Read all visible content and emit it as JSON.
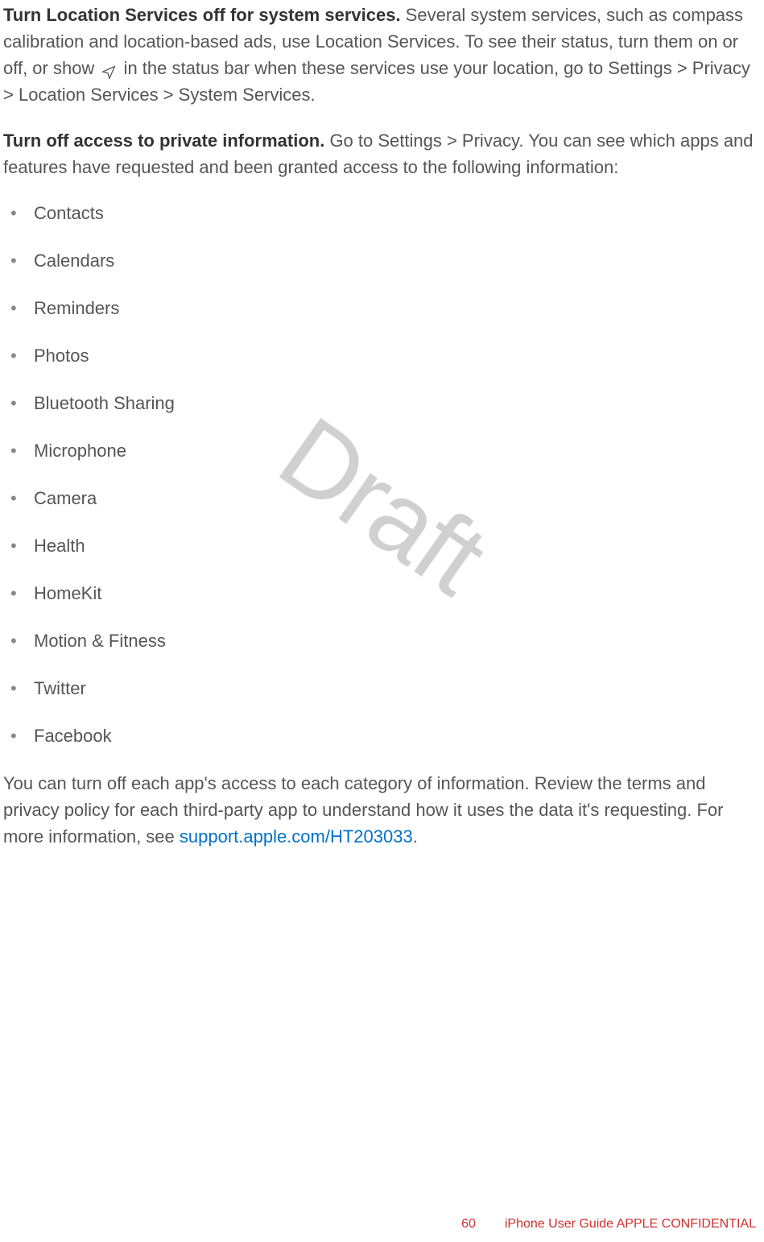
{
  "para1": {
    "bold": "Turn Location Services off for system services.",
    "text1": " Several system services, such as compass calibration and location-based ads, use Location Services. To see their status, turn them on or off, or show ",
    "text2": " in the status bar when these services use your location, go to Settings > Privacy > Location Services > System Services."
  },
  "para2": {
    "bold": "Turn off access to private information.",
    "text": " Go to Settings > Privacy. You can see which apps and features have requested and been granted access to the following information:"
  },
  "list": [
    "Contacts",
    "Calendars",
    "Reminders",
    "Photos",
    "Bluetooth Sharing",
    "Microphone",
    "Camera",
    "Health",
    "HomeKit",
    "Motion & Fitness",
    "Twitter",
    "Facebook"
  ],
  "para3": {
    "text1": "You can turn off each app's access to each category of information. Review the terms and privacy policy for each third-party app to understand how it uses the data it's requesting. For more information, see ",
    "link": "support.apple.com/HT203033",
    "text2": "."
  },
  "watermark": "Draft",
  "footer": {
    "page": "60",
    "text": "iPhone User Guide  APPLE CONFIDENTIAL"
  }
}
